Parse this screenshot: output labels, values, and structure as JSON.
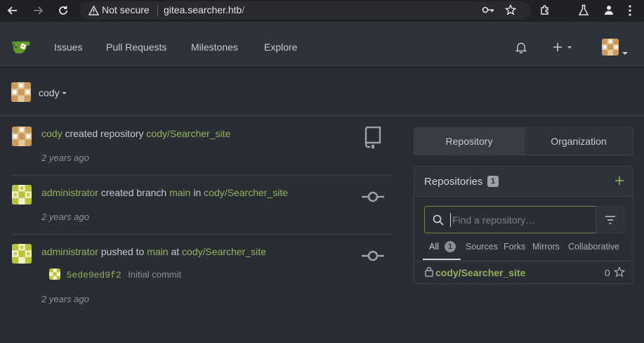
{
  "browser": {
    "security_label": "Not secure",
    "url_host": "gitea.searcher.htb",
    "url_path": "/"
  },
  "header": {
    "nav": [
      "Issues",
      "Pull Requests",
      "Milestones",
      "Explore"
    ],
    "icons": [
      "bell-icon",
      "plus-icon",
      "avatar"
    ]
  },
  "context": {
    "user": "cody"
  },
  "feed": [
    {
      "actor": "cody",
      "action": "created repository",
      "repo": "cody/Searcher_site",
      "time": "2 years ago",
      "icon": "repo-icon"
    },
    {
      "actor": "administrator",
      "action": "created branch",
      "branch": "main",
      "connector": "in",
      "repo": "cody/Searcher_site",
      "time": "2 years ago",
      "icon": "commit-icon"
    },
    {
      "actor": "administrator",
      "action": "pushed to",
      "branch": "main",
      "connector": "at",
      "repo": "cody/Searcher_site",
      "commit_sha": "5ede9ed9f2",
      "commit_msg": "Initial commit",
      "time": "2 years ago",
      "icon": "commit-icon"
    }
  ],
  "right_panel": {
    "tabs": [
      "Repository",
      "Organization"
    ],
    "repos_title": "Repositories",
    "repos_count": "1",
    "search_placeholder": "Find a repository…",
    "subtabs": [
      "All",
      "Sources",
      "Forks",
      "Mirrors",
      "Collaborative"
    ],
    "all_count": "1",
    "repo_list": [
      {
        "name": "cody/Searcher_site",
        "stars": "0"
      }
    ]
  },
  "colors": {
    "accent_green": "#92b25f",
    "background": "#2b2d34",
    "header_bg": "#2e323b"
  }
}
